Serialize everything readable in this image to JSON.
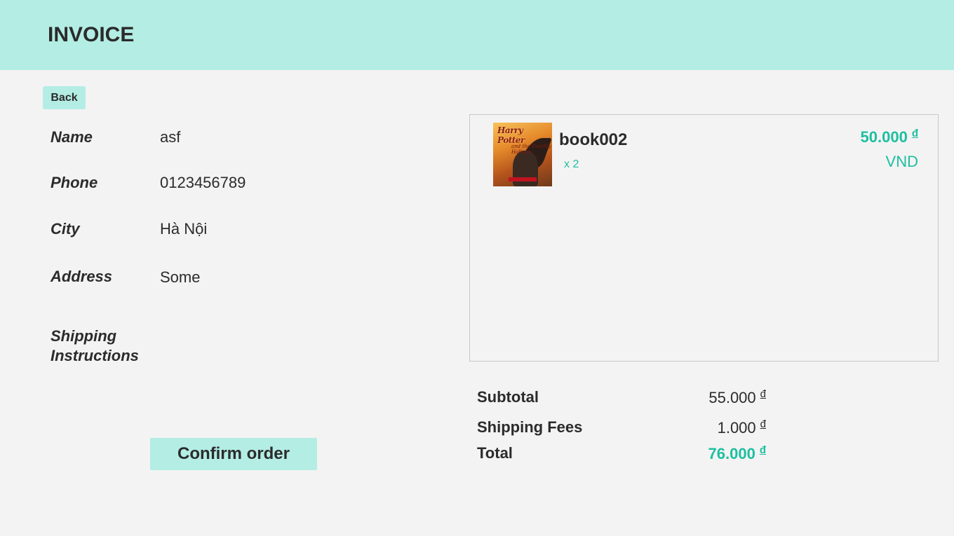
{
  "header": {
    "title": "INVOICE"
  },
  "back_button": {
    "label": "Back"
  },
  "customer": {
    "name": {
      "label": "Name",
      "value": "asf"
    },
    "phone": {
      "label": "Phone",
      "value": "0123456789"
    },
    "city": {
      "label": "City",
      "value": "Hà Nội"
    },
    "address": {
      "label": "Address",
      "value": "Some"
    },
    "shipping_instructions": {
      "label_line1": "Shipping",
      "label_line2": "Instructions",
      "value": ""
    }
  },
  "confirm_button": {
    "label": "Confirm order"
  },
  "cart": {
    "items": [
      {
        "name": "book002",
        "quantity": "x 2",
        "price": "50.000",
        "currency_symbol": "đ",
        "currency_code": "VND",
        "cover_title": "Harry Potter",
        "cover_subtitle": "and the Deathly Hallows"
      }
    ]
  },
  "summary": {
    "subtotal": {
      "label": "Subtotal",
      "value": "55.000",
      "currency_symbol": "đ"
    },
    "shipping": {
      "label": "Shipping Fees",
      "value": "1.000",
      "currency_symbol": "đ"
    },
    "total": {
      "label": "Total",
      "value": "76.000",
      "currency_symbol": "đ"
    }
  },
  "colors": {
    "accent": "#b3ede4",
    "highlight": "#1dbfa0",
    "background": "#f3f3f3",
    "text": "#2b2b2b"
  }
}
